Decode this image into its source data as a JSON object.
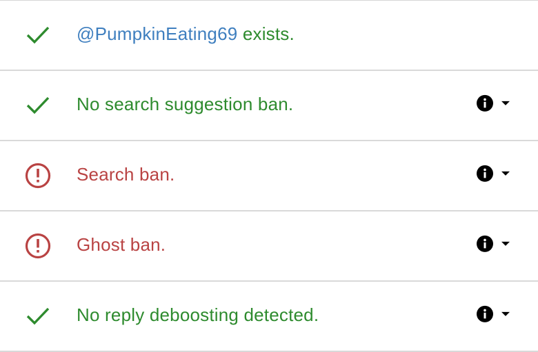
{
  "colors": {
    "success": "#2e8b2e",
    "error": "#b94343",
    "handle": "#3f7fbf"
  },
  "results": [
    {
      "status": "ok",
      "icon": "check-icon",
      "handle": "@PumpkinEating69",
      "text": " exists.",
      "has_info": false
    },
    {
      "status": "ok",
      "icon": "check-icon",
      "text": "No search suggestion ban.",
      "has_info": true
    },
    {
      "status": "bad",
      "icon": "alert-circle-icon",
      "text": "Search ban.",
      "has_info": true
    },
    {
      "status": "bad",
      "icon": "alert-circle-icon",
      "text": "Ghost ban.",
      "has_info": true
    },
    {
      "status": "ok",
      "icon": "check-icon",
      "text": "No reply deboosting detected.",
      "has_info": true
    }
  ]
}
